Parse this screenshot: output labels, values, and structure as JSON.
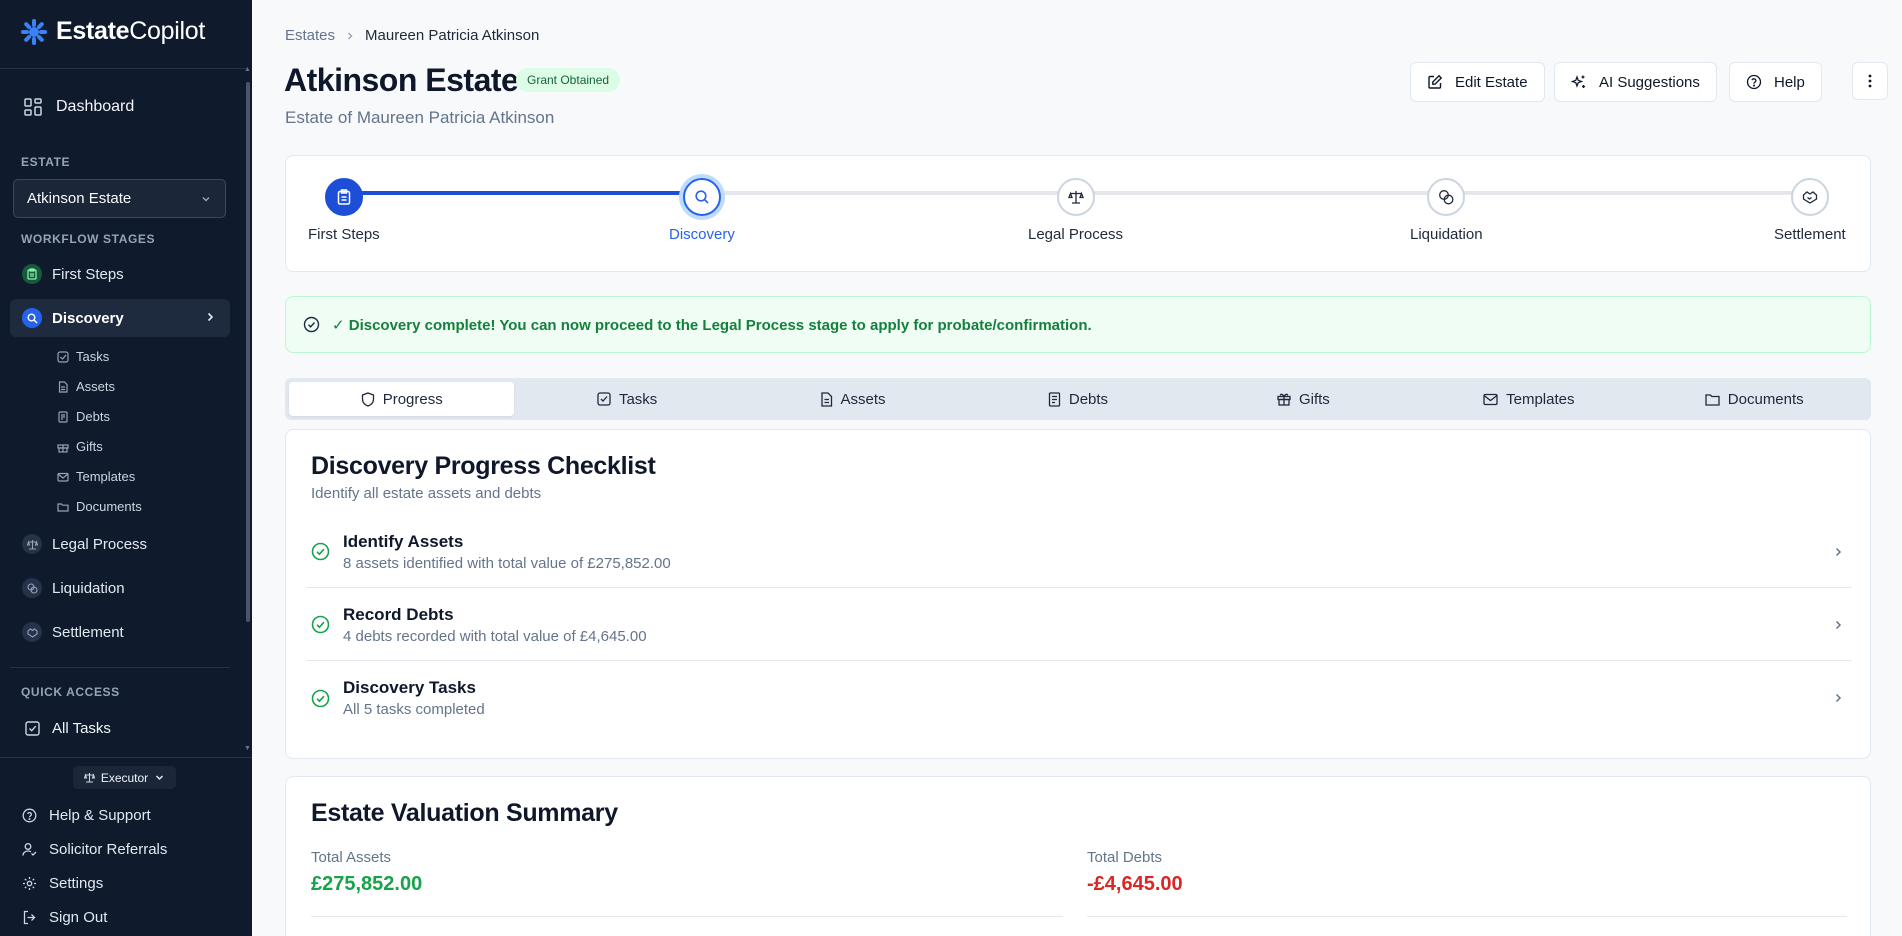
{
  "app": {
    "logo_prefix": "Estate",
    "logo_suffix": "Copilot"
  },
  "sidebar": {
    "dashboard_label": "Dashboard",
    "estate_heading": "ESTATE",
    "estate_selected": "Atkinson Estate",
    "workflow_heading": "WORKFLOW STAGES",
    "stages": [
      {
        "label": "First Steps",
        "icon": "clipboard-icon"
      },
      {
        "label": "Discovery",
        "icon": "search-icon"
      },
      {
        "label": "Legal Process",
        "icon": "scale-icon"
      },
      {
        "label": "Liquidation",
        "icon": "coins-icon"
      },
      {
        "label": "Settlement",
        "icon": "handshake-icon"
      }
    ],
    "discovery_subitems": [
      {
        "label": "Tasks",
        "icon": "check-square-icon"
      },
      {
        "label": "Assets",
        "icon": "file-icon"
      },
      {
        "label": "Debts",
        "icon": "receipt-icon"
      },
      {
        "label": "Gifts",
        "icon": "gift-icon"
      },
      {
        "label": "Templates",
        "icon": "mail-icon"
      },
      {
        "label": "Documents",
        "icon": "folder-icon"
      }
    ],
    "quick_access_heading": "QUICK ACCESS",
    "quick_access": [
      {
        "label": "All Tasks",
        "icon": "check-square-icon"
      }
    ],
    "role_label": "Executor",
    "bottom_links": [
      {
        "label": "Help & Support",
        "icon": "help-circle-icon"
      },
      {
        "label": "Solicitor Referrals",
        "icon": "user-check-icon"
      },
      {
        "label": "Settings",
        "icon": "gear-icon"
      },
      {
        "label": "Sign Out",
        "icon": "sign-out-icon"
      }
    ]
  },
  "header": {
    "breadcrumb": [
      "Estates",
      "Maureen Patricia Atkinson"
    ],
    "title": "Atkinson Estate",
    "status_badge": "Grant Obtained",
    "subtitle": "Estate of Maureen Patricia Atkinson",
    "buttons": {
      "edit": "Edit Estate",
      "ai": "AI Suggestions",
      "help": "Help"
    }
  },
  "stepper": {
    "steps": [
      {
        "label": "First Steps",
        "state": "done",
        "icon": "clipboard-icon"
      },
      {
        "label": "Discovery",
        "state": "current",
        "icon": "search-icon"
      },
      {
        "label": "Legal Process",
        "state": "upcoming",
        "icon": "scale-icon"
      },
      {
        "label": "Liquidation",
        "state": "upcoming",
        "icon": "coins-icon"
      },
      {
        "label": "Settlement",
        "state": "upcoming",
        "icon": "handshake-icon"
      }
    ]
  },
  "alert": {
    "text": "✓ Discovery complete! You can now proceed to the Legal Process stage to apply for probate/confirmation."
  },
  "tabs": [
    {
      "label": "Progress",
      "icon": "shield-icon",
      "active": true
    },
    {
      "label": "Tasks",
      "icon": "check-square-icon",
      "active": false
    },
    {
      "label": "Assets",
      "icon": "file-icon",
      "active": false
    },
    {
      "label": "Debts",
      "icon": "receipt-icon",
      "active": false
    },
    {
      "label": "Gifts",
      "icon": "gift-icon",
      "active": false
    },
    {
      "label": "Templates",
      "icon": "mail-icon",
      "active": false
    },
    {
      "label": "Documents",
      "icon": "folder-icon",
      "active": false
    }
  ],
  "checklist": {
    "title": "Discovery Progress Checklist",
    "description": "Identify all estate assets and debts",
    "items": [
      {
        "title": "Identify Assets",
        "subtitle": "8 assets identified with total value of £275,852.00",
        "complete": true
      },
      {
        "title": "Record Debts",
        "subtitle": "4 debts recorded with total value of £4,645.00",
        "complete": true
      },
      {
        "title": "Discovery Tasks",
        "subtitle": "All 5 tasks completed",
        "complete": true
      }
    ]
  },
  "valuation": {
    "title": "Estate Valuation Summary",
    "total_assets_label": "Total Assets",
    "total_assets_value": "£275,852.00",
    "total_debts_label": "Total Debts",
    "total_debts_value": "-£4,645.00"
  },
  "colors": {
    "sidebar_bg": "#0f1b2d",
    "accent_blue": "#2563eb",
    "success_green": "#16a34a",
    "danger_red": "#dc2626"
  }
}
